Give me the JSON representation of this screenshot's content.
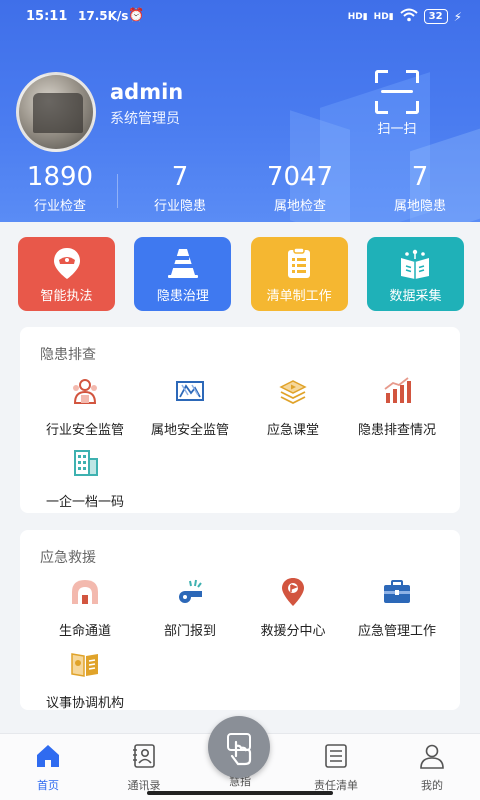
{
  "status_bar": {
    "time": "15:11",
    "speed": "17.5K/s",
    "battery": "32",
    "signal1": "HD",
    "signal2": "HD"
  },
  "user": {
    "name": "admin",
    "role": "系统管理员"
  },
  "scan": {
    "label": "扫一扫"
  },
  "stats": [
    {
      "value": "1890",
      "label": "行业检查"
    },
    {
      "value": "7",
      "label": "行业隐患"
    },
    {
      "value": "7047",
      "label": "属地检查"
    },
    {
      "value": "7",
      "label": "属地隐患"
    }
  ],
  "tiles": [
    {
      "label": "智能执法",
      "color": "#e8584a",
      "icon": "police-cap-icon"
    },
    {
      "label": "隐患治理",
      "color": "#3f79f0",
      "icon": "traffic-cone-icon"
    },
    {
      "label": "清单制工作",
      "color": "#f5b731",
      "icon": "clipboard-list-icon"
    },
    {
      "label": "数据采集",
      "color": "#1fb1b8",
      "icon": "data-book-icon"
    }
  ],
  "hazard_section": {
    "title": "隐患排查",
    "items": [
      {
        "label": "行业安全监管",
        "icon": "people-group-icon"
      },
      {
        "label": "属地安全监管",
        "icon": "map-frame-icon"
      },
      {
        "label": "应急课堂",
        "icon": "video-stack-icon"
      },
      {
        "label": "隐患排查情况",
        "icon": "bar-chart-icon"
      },
      {
        "label": "一企一档一码",
        "icon": "building-icon"
      }
    ]
  },
  "rescue_section": {
    "title": "应急救援",
    "items": [
      {
        "label": "生命通道",
        "icon": "tunnel-icon"
      },
      {
        "label": "部门报到",
        "icon": "whistle-icon"
      },
      {
        "label": "救援分中心",
        "icon": "location-flag-icon"
      },
      {
        "label": "应急管理工作",
        "icon": "briefcase-icon"
      },
      {
        "label": "议事协调机构",
        "icon": "open-book-icon"
      }
    ]
  },
  "bottom_nav": [
    {
      "label": "首页",
      "icon": "home-icon",
      "active": true
    },
    {
      "label": "通讯录",
      "icon": "contacts-icon",
      "active": false
    },
    {
      "label": "慧指",
      "icon": "touch-hand-icon",
      "active": false
    },
    {
      "label": "责任清单",
      "icon": "list-doc-icon",
      "active": false
    },
    {
      "label": "我的",
      "icon": "user-icon",
      "active": false
    }
  ],
  "colors": {
    "header": "#4a7cf0",
    "nav_active": "#2f6bf0",
    "icon_red": "#d2553f",
    "icon_blue": "#2c68b8",
    "icon_gold": "#e0a32a",
    "icon_teal": "#3eb1b0"
  }
}
